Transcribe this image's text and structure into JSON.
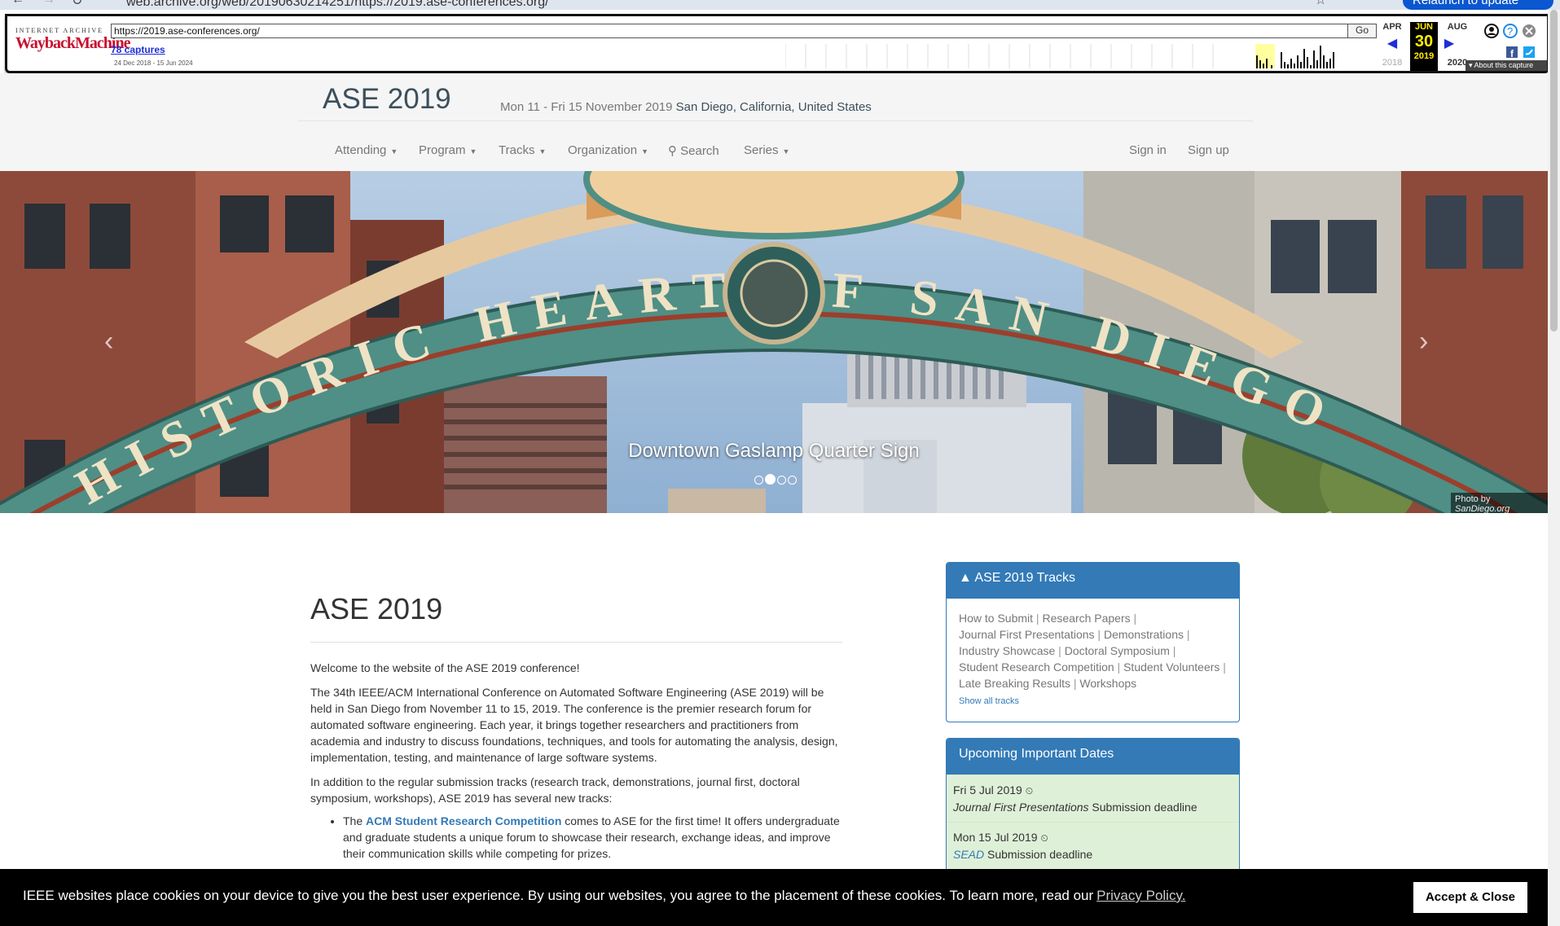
{
  "browser": {
    "url": "web.archive.org/web/20190630214251/https://2019.ase-conferences.org/",
    "relaunch_label": "Relaunch to update"
  },
  "wayback": {
    "logo_top": "INTERNET ARCHIVE",
    "logo_main": "WaybackMachine",
    "url_value": "https://2019.ase-conferences.org/",
    "go_label": "Go",
    "captures": "78 captures",
    "date_range": "24 Dec 2018 - 15 Jun 2024",
    "prev_month": "APR",
    "prev_year": "2018",
    "current_month": "JUN",
    "current_day": "30",
    "current_year": "2019",
    "next_month": "AUG",
    "next_year": "2020",
    "about_label": "About this capture"
  },
  "site": {
    "title": "ASE 2019",
    "dates": "Mon 11 - Fri 15 November 2019",
    "location": "San Diego, California, United States",
    "menu": {
      "attending": "Attending",
      "program": "Program",
      "tracks": "Tracks",
      "organization": "Organization",
      "search": "Search",
      "series": "Series",
      "signin": "Sign in",
      "signup": "Sign up"
    }
  },
  "hero": {
    "sign_text": "HISTORIC HEART OF SAN DIEGO",
    "caption": "Downtown Gaslamp Quarter Sign",
    "photo_credit": "Photo by",
    "photo_source": "SanDiego.org",
    "slides": 4,
    "active_slide": 2
  },
  "main": {
    "heading": "ASE 2019",
    "welcome": "Welcome to the website of the ASE 2019 conference!",
    "intro": "The 34th IEEE/ACM International Conference on Automated Software Engineering (ASE 2019) will be held in San Diego from November 11 to 15, 2019. The conference is the premier research forum for automated software engineering. Each year, it brings together researchers and practitioners from academia and industry to discuss foundations, techniques, and tools for automating the analysis, design, implementation, testing, and maintenance of large software systems.",
    "tracks_intro": "In addition to the regular submission tracks (research track, demonstrations, journal first, doctoral symposium, workshops), ASE 2019 has several new tracks:",
    "bullet1_pre": "The",
    "bullet1_link": "ACM Student Research Competition",
    "bullet1_post": "comes to ASE for the first time! It offers undergraduate and graduate students a unique forum to showcase their research, exchange ideas, and improve their communication skills while competing for prizes."
  },
  "tracks_panel": {
    "title": "ASE 2019 Tracks",
    "links": [
      "How to Submit",
      "Research Papers",
      "Journal First Presentations",
      "Demonstrations",
      "Industry Showcase",
      "Doctoral Symposium",
      "Student Research Competition",
      "Student Volunteers",
      "Late Breaking Results",
      "Workshops"
    ],
    "show_all": "Show all tracks"
  },
  "dates_panel": {
    "title": "Upcoming Important Dates",
    "items": [
      {
        "date": "Fri 5 Jul 2019",
        "track": "Journal First Presentations",
        "label": "Submission deadline"
      },
      {
        "date": "Mon 15 Jul 2019",
        "track": "SEAD",
        "label": "Submission deadline"
      }
    ]
  },
  "cookie": {
    "message": "IEEE websites place cookies on your device to give you the best user experience. By using our websites, you agree to the placement of these cookies. To learn more, read our",
    "link": "Privacy Policy.",
    "button": "Accept & Close"
  },
  "colors": {
    "primary": "#337ab7",
    "wayback_red": "#c8102e",
    "date_row_bg": "#dff0d8",
    "arch_teal": "#4f8f86"
  }
}
